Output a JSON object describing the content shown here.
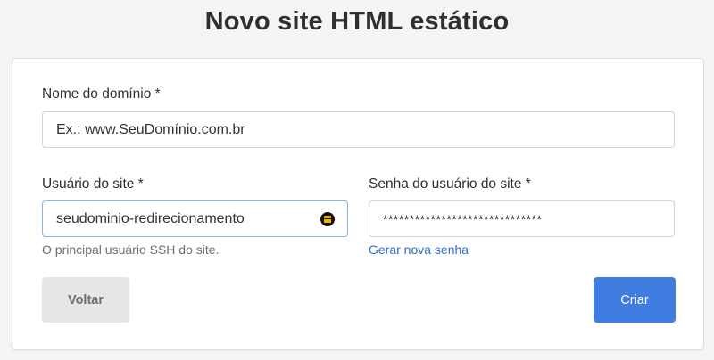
{
  "page": {
    "title": "Novo site HTML estático"
  },
  "form": {
    "domain": {
      "label": "Nome do domínio *",
      "placeholder": "Ex.: www.SeuDomínio.com.br"
    },
    "site_user": {
      "label": "Usuário do site *",
      "value": "seudominio-redirecionamento",
      "help": "O principal usuário SSH do site.",
      "manager_icon": "password-manager-icon"
    },
    "site_password": {
      "label": "Senha do usuário do site *",
      "value": "******************************",
      "generate_link": "Gerar nova senha"
    },
    "buttons": {
      "back": "Voltar",
      "create": "Criar"
    }
  },
  "colors": {
    "primary": "#3f7de0",
    "link": "#2f6fcf",
    "secondary_button": "#e6e6e6"
  }
}
